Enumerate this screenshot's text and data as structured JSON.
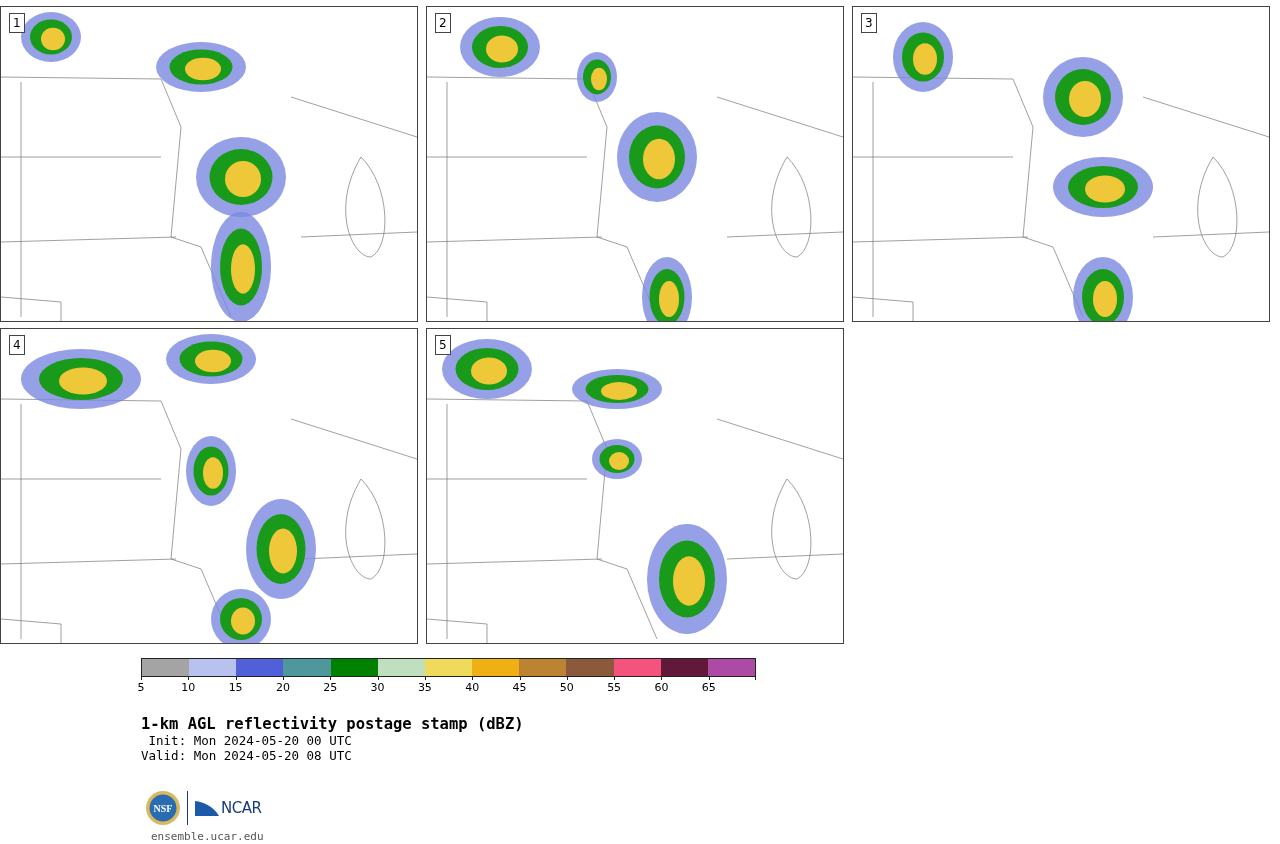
{
  "panels": [
    {
      "label": "1"
    },
    {
      "label": "2"
    },
    {
      "label": "3"
    },
    {
      "label": "4"
    },
    {
      "label": "5"
    }
  ],
  "colorbar": {
    "segments": [
      {
        "tick": "5",
        "color": "#a4a4a4"
      },
      {
        "tick": "10",
        "color": "#b8c2ee"
      },
      {
        "tick": "15",
        "color": "#5160d8"
      },
      {
        "tick": "20",
        "color": "#4e979c"
      },
      {
        "tick": "25",
        "color": "#008200"
      },
      {
        "tick": "30",
        "color": "#bfdfbf"
      },
      {
        "tick": "35",
        "color": "#f0da5c"
      },
      {
        "tick": "40",
        "color": "#efb016"
      },
      {
        "tick": "45",
        "color": "#bb8332"
      },
      {
        "tick": "50",
        "color": "#8b5a3c"
      },
      {
        "tick": "55",
        "color": "#f5527e"
      },
      {
        "tick": "60",
        "color": "#621838"
      },
      {
        "tick": "65",
        "color": "#ad4aa6"
      }
    ]
  },
  "title": "1-km AGL reflectivity postage stamp (dBZ)",
  "init": " Init: Mon 2024-05-20 00 UTC",
  "valid": "Valid: Mon 2024-05-20 08 UTC",
  "logos": {
    "nsf": "NSF",
    "ncar": "NCAR"
  },
  "url": "ensemble.ucar.edu"
}
